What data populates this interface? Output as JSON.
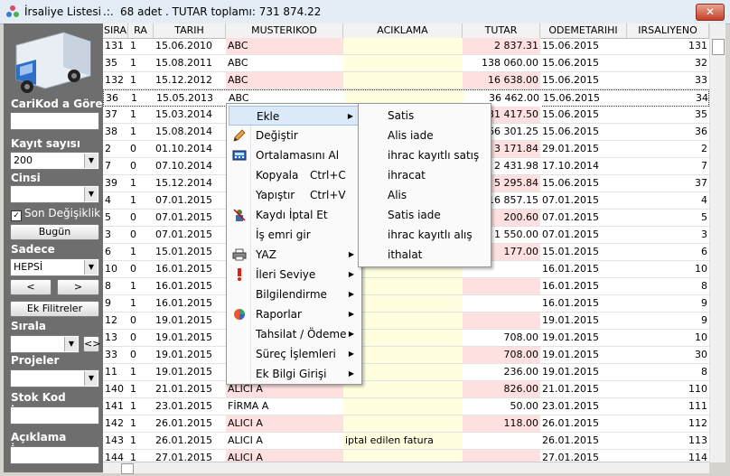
{
  "window": {
    "title": "İrsaliye Listesi",
    "separator": ".:.",
    "summary": "68 adet . TUTAR toplamı: 731 874.22",
    "close": "✕"
  },
  "sidebar": {
    "carikod_label": "CariKod a Göre",
    "carikod_value": "",
    "kayit_label": "Kayıt sayısı",
    "kayit_value": "200",
    "cinsi_label": "Cinsi",
    "cinsi_value": "",
    "son_degisiklik_label": "Son Değişiklik",
    "son_degisiklik_checked": "✓",
    "bugun_button": "Bugün",
    "sadece_label": "Sadece",
    "sadece_value": "HEPSİ",
    "prev_button": "<",
    "next_button": ">",
    "ek_filtreler_button": "Ek Filitreler",
    "sirala_label": "Sırala",
    "sirala_value": "",
    "sirala_toggle": "<>",
    "projeler_label": "Projeler",
    "projeler_value": "",
    "stok_kod_label": "Stok Kod içeren",
    "stok_kod_value": "",
    "aciklama_label": "Açıklama İçeren",
    "aciklama_value": ""
  },
  "table": {
    "columns": [
      "SIRA",
      "RA",
      "TARIH",
      "MUSTERIKOD",
      "ACIKLAMA",
      "TUTAR",
      "ODEMETARIHI",
      "IRSALIYENO"
    ],
    "rows": [
      [
        "131",
        "1",
        "15.06.2010",
        "ABC",
        "",
        "2 837.31",
        "15.06.2015",
        "131"
      ],
      [
        "35",
        "1",
        "15.08.2011",
        "ABC",
        "",
        "138 060.00",
        "15.06.2015",
        "32"
      ],
      [
        "132",
        "1",
        "15.12.2012",
        "ABC",
        "",
        "16 638.00",
        "15.06.2015",
        "33"
      ],
      [
        "36",
        "1",
        "15.05.2013",
        "ABC",
        "",
        "36 462.00",
        "15.06.2015",
        "34"
      ],
      [
        "37",
        "1",
        "15.03.2014",
        "",
        "",
        "31 417.50",
        "15.06.2015",
        "35"
      ],
      [
        "38",
        "1",
        "15.08.2014",
        "",
        "",
        "66 301.25",
        "15.06.2015",
        "36"
      ],
      [
        "2",
        "0",
        "01.10.2014",
        "",
        "",
        "3 171.84",
        "29.01.2015",
        "2"
      ],
      [
        "7",
        "0",
        "07.10.2014",
        "",
        "",
        "2 431.98",
        "17.10.2014",
        "7"
      ],
      [
        "39",
        "1",
        "15.12.2014",
        "",
        "",
        "5 295.84",
        "15.06.2015",
        "37"
      ],
      [
        "4",
        "1",
        "07.01.2015",
        "",
        "",
        "16 857.15",
        "07.01.2015",
        "4"
      ],
      [
        "5",
        "0",
        "07.01.2015",
        "",
        "",
        "200.60",
        "07.01.2015",
        "5"
      ],
      [
        "3",
        "0",
        "07.01.2015",
        "",
        "",
        "1 550.00",
        "07.01.2015",
        "3"
      ],
      [
        "6",
        "1",
        "15.01.2015",
        "",
        "",
        "177.00",
        "15.01.2015",
        "6"
      ],
      [
        "10",
        "0",
        "16.01.2015",
        "",
        "",
        "",
        "16.01.2015",
        "10"
      ],
      [
        "8",
        "1",
        "16.01.2015",
        "",
        "",
        "",
        "16.01.2015",
        "8"
      ],
      [
        "9",
        "1",
        "16.01.2015",
        "",
        "",
        "",
        "16.01.2015",
        "9"
      ],
      [
        "12",
        "0",
        "19.01.2015",
        "",
        "",
        "",
        "19.01.2015",
        "9"
      ],
      [
        "13",
        "0",
        "19.01.2015",
        "",
        "",
        "708.00",
        "19.01.2015",
        "10"
      ],
      [
        "33",
        "0",
        "19.01.2015",
        "",
        "",
        "708.00",
        "19.01.2015",
        "30"
      ],
      [
        "11",
        "1",
        "19.01.2015",
        "",
        "",
        "236.00",
        "19.01.2015",
        "8"
      ],
      [
        "140",
        "1",
        "21.01.2015",
        "ALICI A",
        "",
        "826.00",
        "21.01.2015",
        "110"
      ],
      [
        "141",
        "1",
        "23.01.2015",
        "FİRMA A",
        "",
        "50.00",
        "23.01.2015",
        "111"
      ],
      [
        "142",
        "1",
        "26.01.2015",
        "ALICI A",
        "",
        "118.00",
        "26.01.2015",
        "112"
      ],
      [
        "143",
        "1",
        "26.01.2015",
        "ALICI A",
        "iptal edilen fatura",
        "",
        "26.01.2015",
        "113"
      ],
      [
        "144",
        "1",
        "27.01.2015",
        "ALICI A",
        "",
        "",
        "27.01.2015",
        "114"
      ]
    ]
  },
  "context_menu": {
    "items": [
      {
        "label": "Ekle",
        "shortcut": "",
        "arrow": "▶",
        "icon": ""
      },
      {
        "label": "Değiştir",
        "shortcut": "",
        "arrow": "",
        "icon": "pencil-icon"
      },
      {
        "label": "Ortalamasını Al",
        "shortcut": "",
        "arrow": "",
        "icon": "calculator-icon"
      },
      {
        "label": "Kopyala",
        "shortcut": "Ctrl+C",
        "arrow": "",
        "icon": ""
      },
      {
        "label": "Yapıştır",
        "shortcut": "Ctrl+V",
        "arrow": "",
        "icon": ""
      },
      {
        "label": "Kaydı İptal Et",
        "shortcut": "",
        "arrow": "",
        "icon": "cancel-record-icon"
      },
      {
        "label": "İş emri gir",
        "shortcut": "",
        "arrow": "",
        "icon": ""
      },
      {
        "label": "YAZ",
        "shortcut": "",
        "arrow": "▶",
        "icon": "printer-icon"
      },
      {
        "label": "İleri Seviye",
        "shortcut": "",
        "arrow": "▶",
        "icon": "exclamation-icon"
      },
      {
        "label": "Bilgilendirme",
        "shortcut": "",
        "arrow": "▶",
        "icon": ""
      },
      {
        "label": "Raporlar",
        "shortcut": "",
        "arrow": "▶",
        "icon": "reports-icon"
      },
      {
        "label": "Tahsilat / Ödeme",
        "shortcut": "",
        "arrow": "▶",
        "icon": ""
      },
      {
        "label": "Süreç İşlemleri",
        "shortcut": "",
        "arrow": "▶",
        "icon": ""
      },
      {
        "label": "Ek Bilgi Girişi",
        "shortcut": "",
        "arrow": "▶",
        "icon": ""
      }
    ]
  },
  "submenu": {
    "items": [
      "Satis",
      "Alis iade",
      "ihrac kayıtlı satış",
      "ihracat",
      "Alis",
      "Satis iade",
      "ihrac kayıtlı alış",
      "ithalat"
    ]
  },
  "colors": {
    "pink": "#ffe0e0",
    "yellow": "#ffffe0",
    "sidebar": "#6e6e6e"
  }
}
